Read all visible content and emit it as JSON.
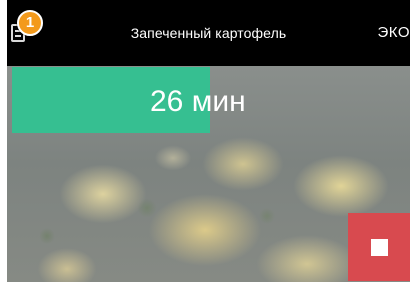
{
  "header": {
    "title": "Запеченный картофель",
    "mode": "ЭКО",
    "notification_count": "1",
    "menu_icon": "document-list-icon"
  },
  "timer": {
    "value": "26",
    "unit": "мин",
    "accent_color": "#36bf91"
  },
  "controls": {
    "stop_icon": "stop-icon",
    "stop_color": "#d84a4f"
  },
  "colors": {
    "badge": "#f39a1c"
  }
}
